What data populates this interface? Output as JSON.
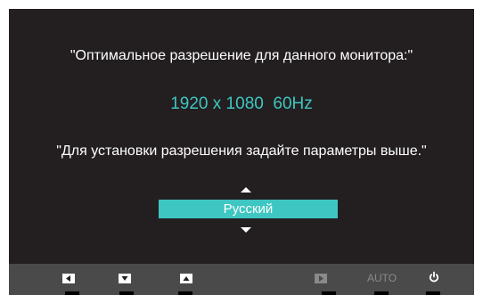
{
  "osd": {
    "message_optimal": "\"Оптимальное разрешение для данного монитора:\"",
    "resolution": "1920 x 1080  60Hz",
    "message_setup": "\"Для установки разрешения задайте параметры выше.\"",
    "language_selected": "Русский"
  },
  "buttons": {
    "auto_label": "AUTO",
    "icons": [
      "left-arrow-icon",
      "down-arrow-icon",
      "up-arrow-icon",
      "right-arrow-icon",
      "power-icon"
    ]
  },
  "colors": {
    "background": "#231f20",
    "accent": "#3ec6c2",
    "bar": "#4b4a4b",
    "disabled": "#8b898a"
  }
}
